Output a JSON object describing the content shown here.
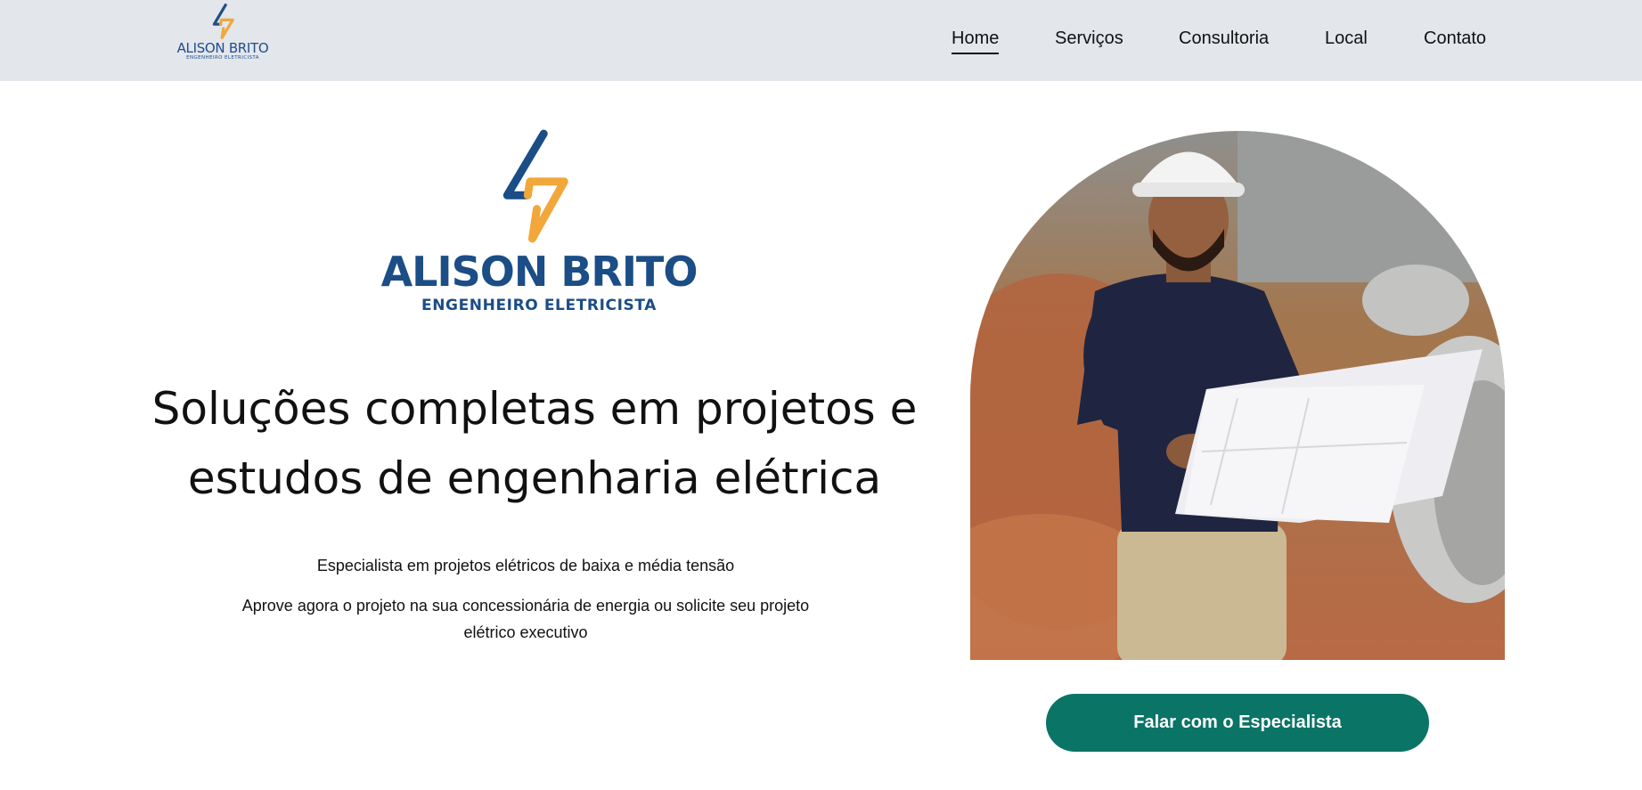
{
  "brand": {
    "name": "ALISON BRITO",
    "tagline": "ENGENHEIRO ELETRICISTA",
    "icon": "lightning-bolt-icon",
    "colors": {
      "blue": "#1b4d86",
      "orange": "#f1a73a"
    }
  },
  "nav": {
    "items": [
      {
        "label": "Home",
        "active": true
      },
      {
        "label": "Serviços",
        "active": false
      },
      {
        "label": "Consultoria",
        "active": false
      },
      {
        "label": "Local",
        "active": false
      },
      {
        "label": "Contato",
        "active": false
      }
    ]
  },
  "hero": {
    "headline": "Soluções completas em projetos e estudos de engenharia elétrica",
    "subtitle": "Especialista em projetos elétricos de baixa e média tensão",
    "description": "Aprove agora o projeto na sua concessionária de energia ou solicite seu projeto elétrico executivo",
    "cta_label": "Falar com o Especialista"
  },
  "theme": {
    "header_bg": "#e3e6eb",
    "cta_bg": "#0a7467"
  }
}
